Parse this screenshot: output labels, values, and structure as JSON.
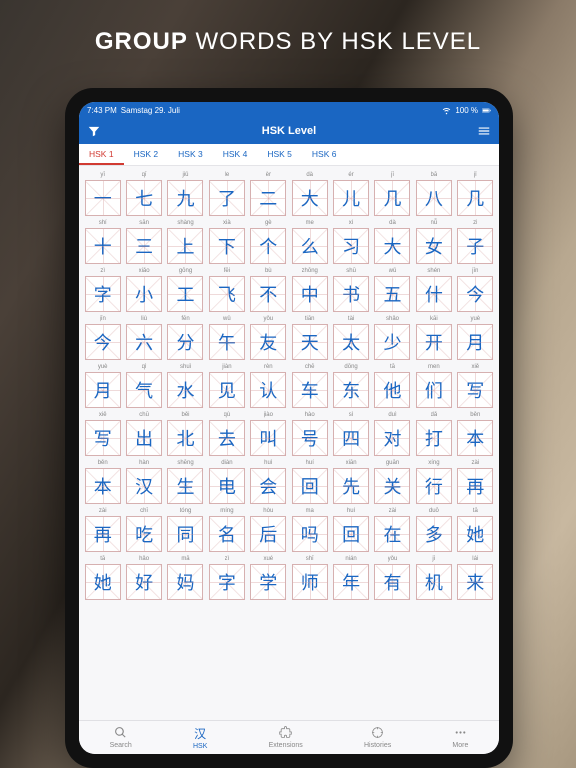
{
  "headline": {
    "bold": "GROUP",
    "rest": " WORDS BY HSK LEVEL"
  },
  "status": {
    "time": "7:43 PM",
    "date": "Samstag 29. Juli",
    "battery": "100 %"
  },
  "nav": {
    "title": "HSK Level"
  },
  "tabs": [
    "HSK 1",
    "HSK 2",
    "HSK 3",
    "HSK 4",
    "HSK 5",
    "HSK 6"
  ],
  "active_tab": 0,
  "tabbar": [
    {
      "label": "Search"
    },
    {
      "label": "HSK",
      "prefix": "汉",
      "active": true
    },
    {
      "label": "Extensions"
    },
    {
      "label": "Histories"
    },
    {
      "label": "More"
    }
  ],
  "cells": [
    {
      "p": "yī",
      "c": "一"
    },
    {
      "p": "qī",
      "c": "七"
    },
    {
      "p": "jiǔ",
      "c": "九"
    },
    {
      "p": "le",
      "c": "了"
    },
    {
      "p": "èr",
      "c": "二"
    },
    {
      "p": "dà",
      "c": "大"
    },
    {
      "p": "ér",
      "c": "儿"
    },
    {
      "p": "jī",
      "c": "几"
    },
    {
      "p": "bā",
      "c": "八"
    },
    {
      "p": "jǐ",
      "c": "几"
    },
    {
      "p": "shí",
      "c": "十"
    },
    {
      "p": "sān",
      "c": "三"
    },
    {
      "p": "shàng",
      "c": "上"
    },
    {
      "p": "xià",
      "c": "下"
    },
    {
      "p": "gè",
      "c": "个"
    },
    {
      "p": "me",
      "c": "么"
    },
    {
      "p": "xí",
      "c": "习"
    },
    {
      "p": "dà",
      "c": "大"
    },
    {
      "p": "nǚ",
      "c": "女"
    },
    {
      "p": "zǐ",
      "c": "子"
    },
    {
      "p": "zì",
      "c": "字"
    },
    {
      "p": "xiǎo",
      "c": "小"
    },
    {
      "p": "gōng",
      "c": "工"
    },
    {
      "p": "fēi",
      "c": "飞"
    },
    {
      "p": "bù",
      "c": "不"
    },
    {
      "p": "zhōng",
      "c": "中"
    },
    {
      "p": "shū",
      "c": "书"
    },
    {
      "p": "wǔ",
      "c": "五"
    },
    {
      "p": "shén",
      "c": "什"
    },
    {
      "p": "jīn",
      "c": "今"
    },
    {
      "p": "jīn",
      "c": "今"
    },
    {
      "p": "liù",
      "c": "六"
    },
    {
      "p": "fēn",
      "c": "分"
    },
    {
      "p": "wǔ",
      "c": "午"
    },
    {
      "p": "yǒu",
      "c": "友"
    },
    {
      "p": "tiān",
      "c": "天"
    },
    {
      "p": "tài",
      "c": "太"
    },
    {
      "p": "shǎo",
      "c": "少"
    },
    {
      "p": "kāi",
      "c": "开"
    },
    {
      "p": "yuè",
      "c": "月"
    },
    {
      "p": "yuè",
      "c": "月"
    },
    {
      "p": "qì",
      "c": "气"
    },
    {
      "p": "shuǐ",
      "c": "水"
    },
    {
      "p": "jiàn",
      "c": "见"
    },
    {
      "p": "rèn",
      "c": "认"
    },
    {
      "p": "chē",
      "c": "车"
    },
    {
      "p": "dōng",
      "c": "东"
    },
    {
      "p": "tā",
      "c": "他"
    },
    {
      "p": "men",
      "c": "们"
    },
    {
      "p": "xiě",
      "c": "写"
    },
    {
      "p": "xiě",
      "c": "写"
    },
    {
      "p": "chū",
      "c": "出"
    },
    {
      "p": "běi",
      "c": "北"
    },
    {
      "p": "qù",
      "c": "去"
    },
    {
      "p": "jiào",
      "c": "叫"
    },
    {
      "p": "hào",
      "c": "号"
    },
    {
      "p": "sì",
      "c": "四"
    },
    {
      "p": "duì",
      "c": "对"
    },
    {
      "p": "dǎ",
      "c": "打"
    },
    {
      "p": "běn",
      "c": "本"
    },
    {
      "p": "běn",
      "c": "本"
    },
    {
      "p": "hàn",
      "c": "汉"
    },
    {
      "p": "shēng",
      "c": "生"
    },
    {
      "p": "diàn",
      "c": "电"
    },
    {
      "p": "huì",
      "c": "会"
    },
    {
      "p": "huí",
      "c": "回"
    },
    {
      "p": "xiān",
      "c": "先"
    },
    {
      "p": "guān",
      "c": "关"
    },
    {
      "p": "xíng",
      "c": "行"
    },
    {
      "p": "zài",
      "c": "再"
    },
    {
      "p": "zài",
      "c": "再"
    },
    {
      "p": "chī",
      "c": "吃"
    },
    {
      "p": "tóng",
      "c": "同"
    },
    {
      "p": "míng",
      "c": "名"
    },
    {
      "p": "hòu",
      "c": "后"
    },
    {
      "p": "ma",
      "c": "吗"
    },
    {
      "p": "huí",
      "c": "回"
    },
    {
      "p": "zài",
      "c": "在"
    },
    {
      "p": "duō",
      "c": "多"
    },
    {
      "p": "tā",
      "c": "她"
    },
    {
      "p": "tā",
      "c": "她"
    },
    {
      "p": "hǎo",
      "c": "好"
    },
    {
      "p": "mā",
      "c": "妈"
    },
    {
      "p": "zì",
      "c": "字"
    },
    {
      "p": "xué",
      "c": "学"
    },
    {
      "p": "shī",
      "c": "师"
    },
    {
      "p": "nián",
      "c": "年"
    },
    {
      "p": "yǒu",
      "c": "有"
    },
    {
      "p": "jī",
      "c": "机"
    },
    {
      "p": "lái",
      "c": "来"
    }
  ]
}
